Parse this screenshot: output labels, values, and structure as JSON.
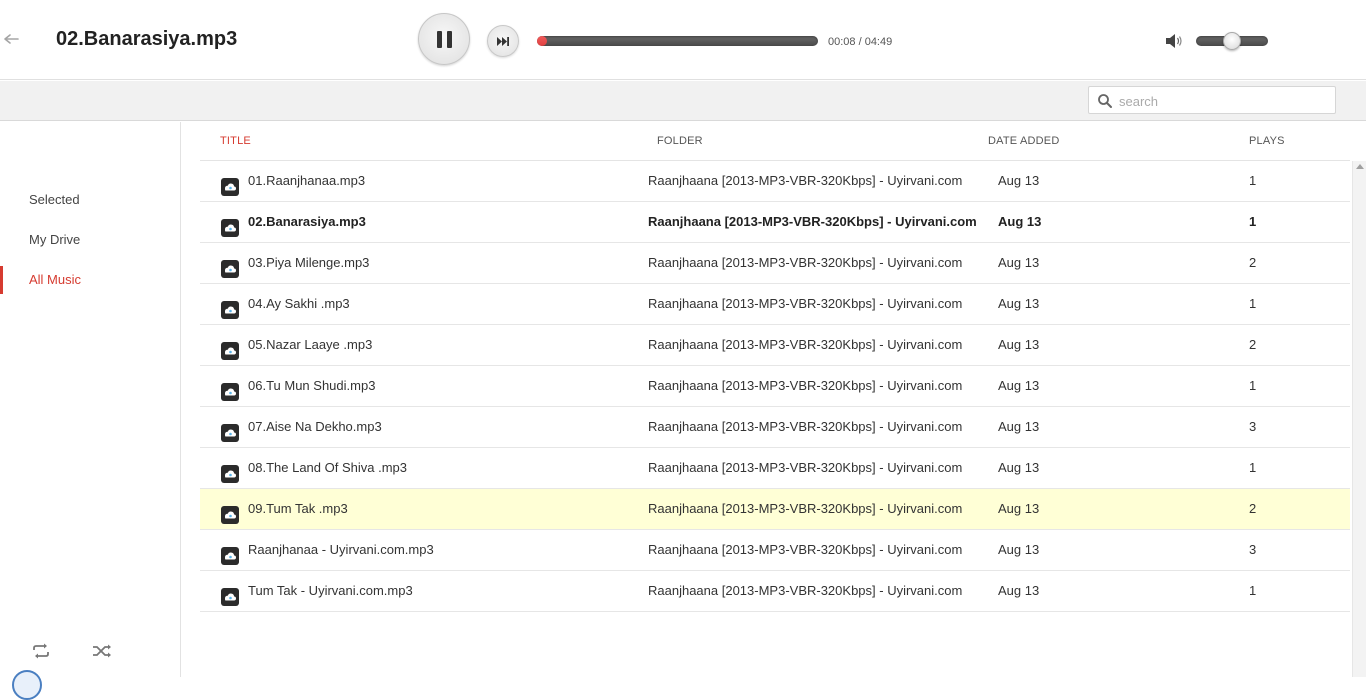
{
  "player": {
    "now_playing": "02.Banarasiya.mp3",
    "elapsed": "00:08",
    "duration": "04:49",
    "time_display": "00:08 / 04:49",
    "progress_fraction": 0.028,
    "volume_fraction": 0.5
  },
  "search": {
    "placeholder": "search",
    "value": ""
  },
  "sidebar": {
    "items": [
      {
        "label": "Selected",
        "active": false
      },
      {
        "label": "My Drive",
        "active": false
      },
      {
        "label": "All Music",
        "active": true
      }
    ]
  },
  "table": {
    "columns": {
      "title": "TITLE",
      "folder": "FOLDER",
      "date": "DATE ADDED",
      "plays": "PLAYS"
    },
    "sorted_by": "title",
    "rows": [
      {
        "title": "01.Raanjhanaa.mp3",
        "folder": "Raanjhaana [2013-MP3-VBR-320Kbps] - Uyirvani.com",
        "date": "Aug 13",
        "plays": "1",
        "current": false,
        "highlighted": false
      },
      {
        "title": "02.Banarasiya.mp3",
        "folder": "Raanjhaana [2013-MP3-VBR-320Kbps] - Uyirvani.com",
        "date": "Aug 13",
        "plays": "1",
        "current": true,
        "highlighted": false
      },
      {
        "title": "03.Piya Milenge.mp3",
        "folder": "Raanjhaana [2013-MP3-VBR-320Kbps] - Uyirvani.com",
        "date": "Aug 13",
        "plays": "2",
        "current": false,
        "highlighted": false
      },
      {
        "title": "04.Ay Sakhi .mp3",
        "folder": "Raanjhaana [2013-MP3-VBR-320Kbps] - Uyirvani.com",
        "date": "Aug 13",
        "plays": "1",
        "current": false,
        "highlighted": false
      },
      {
        "title": "05.Nazar Laaye .mp3",
        "folder": "Raanjhaana [2013-MP3-VBR-320Kbps] - Uyirvani.com",
        "date": "Aug 13",
        "plays": "2",
        "current": false,
        "highlighted": false
      },
      {
        "title": "06.Tu Mun Shudi.mp3",
        "folder": "Raanjhaana [2013-MP3-VBR-320Kbps] - Uyirvani.com",
        "date": "Aug 13",
        "plays": "1",
        "current": false,
        "highlighted": false
      },
      {
        "title": "07.Aise Na Dekho.mp3",
        "folder": "Raanjhaana [2013-MP3-VBR-320Kbps] - Uyirvani.com",
        "date": "Aug 13",
        "plays": "3",
        "current": false,
        "highlighted": false
      },
      {
        "title": "08.The Land Of Shiva .mp3",
        "folder": "Raanjhaana [2013-MP3-VBR-320Kbps] - Uyirvani.com",
        "date": "Aug 13",
        "plays": "1",
        "current": false,
        "highlighted": false
      },
      {
        "title": "09.Tum Tak .mp3",
        "folder": "Raanjhaana [2013-MP3-VBR-320Kbps] - Uyirvani.com",
        "date": "Aug 13",
        "plays": "2",
        "current": false,
        "highlighted": true
      },
      {
        "title": "Raanjhanaa - Uyirvani.com.mp3",
        "folder": "Raanjhaana [2013-MP3-VBR-320Kbps] - Uyirvani.com",
        "date": "Aug 13",
        "plays": "3",
        "current": false,
        "highlighted": false
      },
      {
        "title": "Tum Tak - Uyirvani.com.mp3",
        "folder": "Raanjhaana [2013-MP3-VBR-320Kbps] - Uyirvani.com",
        "date": "Aug 13",
        "plays": "1",
        "current": false,
        "highlighted": false
      }
    ]
  },
  "icons": {
    "back": "back-arrow-icon",
    "pause": "pause-icon",
    "next": "skip-next-icon",
    "volume": "speaker-icon",
    "search": "magnifier-icon",
    "track": "cloud-music-icon",
    "repeat": "repeat-icon",
    "shuffle": "shuffle-icon"
  },
  "colors": {
    "accent": "#d63b30",
    "highlight_row": "#ffffd6",
    "progress_fill": "#e04040"
  }
}
